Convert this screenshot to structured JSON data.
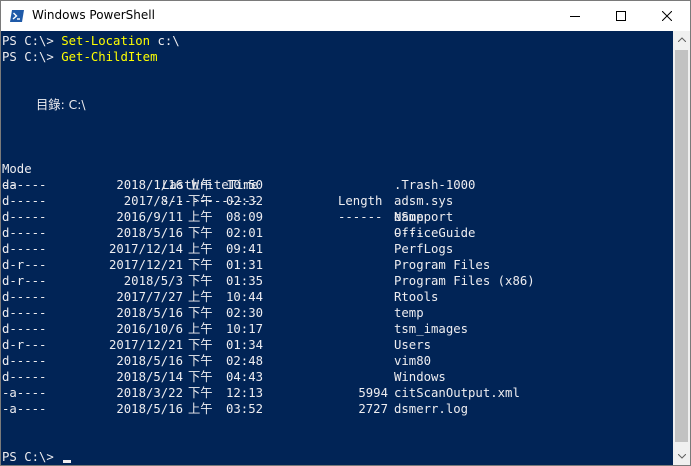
{
  "window": {
    "title": "Windows PowerShell",
    "min_icon": "minimize-icon",
    "max_icon": "maximize-icon",
    "close_icon": "close-icon"
  },
  "colors": {
    "console_bg": "#012456",
    "console_text": "#eeedf0",
    "command_text": "#ffff00"
  },
  "console": {
    "prompt": "PS C:\\> ",
    "commands": [
      {
        "prompt": "PS C:\\> ",
        "cmd": "Set-Location",
        "arg": " c:\\"
      },
      {
        "prompt": "PS C:\\> ",
        "cmd": "Get-ChildItem",
        "arg": ""
      }
    ],
    "directory_label": "目錄: C:\\",
    "headers": {
      "mode": "Mode",
      "lastwritetime": "LastWriteTime",
      "length": "Length",
      "name": "Name"
    },
    "underlines": {
      "mode": "----",
      "lastwritetime": "-------------",
      "length": "------",
      "name": "----"
    },
    "rows": [
      {
        "mode": "da----",
        "date": "2018/1/16",
        "ampm": "上午",
        "time": "10:50",
        "length": "",
        "name": ".Trash-1000"
      },
      {
        "mode": "d-----",
        "date": "2017/8/1",
        "ampm": "下午",
        "time": "02:32",
        "length": "",
        "name": "adsm.sys"
      },
      {
        "mode": "d-----",
        "date": "2016/9/11",
        "ampm": "上午",
        "time": "08:09",
        "length": "",
        "name": "eSupport"
      },
      {
        "mode": "d-----",
        "date": "2018/5/16",
        "ampm": "下午",
        "time": "02:01",
        "length": "",
        "name": "OfficeGuide"
      },
      {
        "mode": "d-----",
        "date": "2017/12/14",
        "ampm": "上午",
        "time": "09:41",
        "length": "",
        "name": "PerfLogs"
      },
      {
        "mode": "d-r---",
        "date": "2017/12/21",
        "ampm": "下午",
        "time": "01:31",
        "length": "",
        "name": "Program Files"
      },
      {
        "mode": "d-r---",
        "date": "2018/5/3",
        "ampm": "下午",
        "time": "01:35",
        "length": "",
        "name": "Program Files (x86)"
      },
      {
        "mode": "d-----",
        "date": "2017/7/27",
        "ampm": "上午",
        "time": "10:44",
        "length": "",
        "name": "Rtools"
      },
      {
        "mode": "d-----",
        "date": "2018/5/16",
        "ampm": "下午",
        "time": "02:30",
        "length": "",
        "name": "temp"
      },
      {
        "mode": "d-----",
        "date": "2016/10/6",
        "ampm": "上午",
        "time": "10:17",
        "length": "",
        "name": "tsm_images"
      },
      {
        "mode": "d-r---",
        "date": "2017/12/21",
        "ampm": "下午",
        "time": "01:34",
        "length": "",
        "name": "Users"
      },
      {
        "mode": "d-----",
        "date": "2018/5/16",
        "ampm": "下午",
        "time": "02:48",
        "length": "",
        "name": "vim80"
      },
      {
        "mode": "d-----",
        "date": "2018/5/14",
        "ampm": "下午",
        "time": "04:43",
        "length": "",
        "name": "Windows"
      },
      {
        "mode": "-a----",
        "date": "2018/3/22",
        "ampm": "下午",
        "time": "12:13",
        "length": "5994",
        "name": "citScanOutput.xml"
      },
      {
        "mode": "-a----",
        "date": "2018/5/16",
        "ampm": "上午",
        "time": "03:52",
        "length": "2727",
        "name": "dsmerr.log"
      }
    ],
    "final_prompt": "PS C:\\> "
  }
}
